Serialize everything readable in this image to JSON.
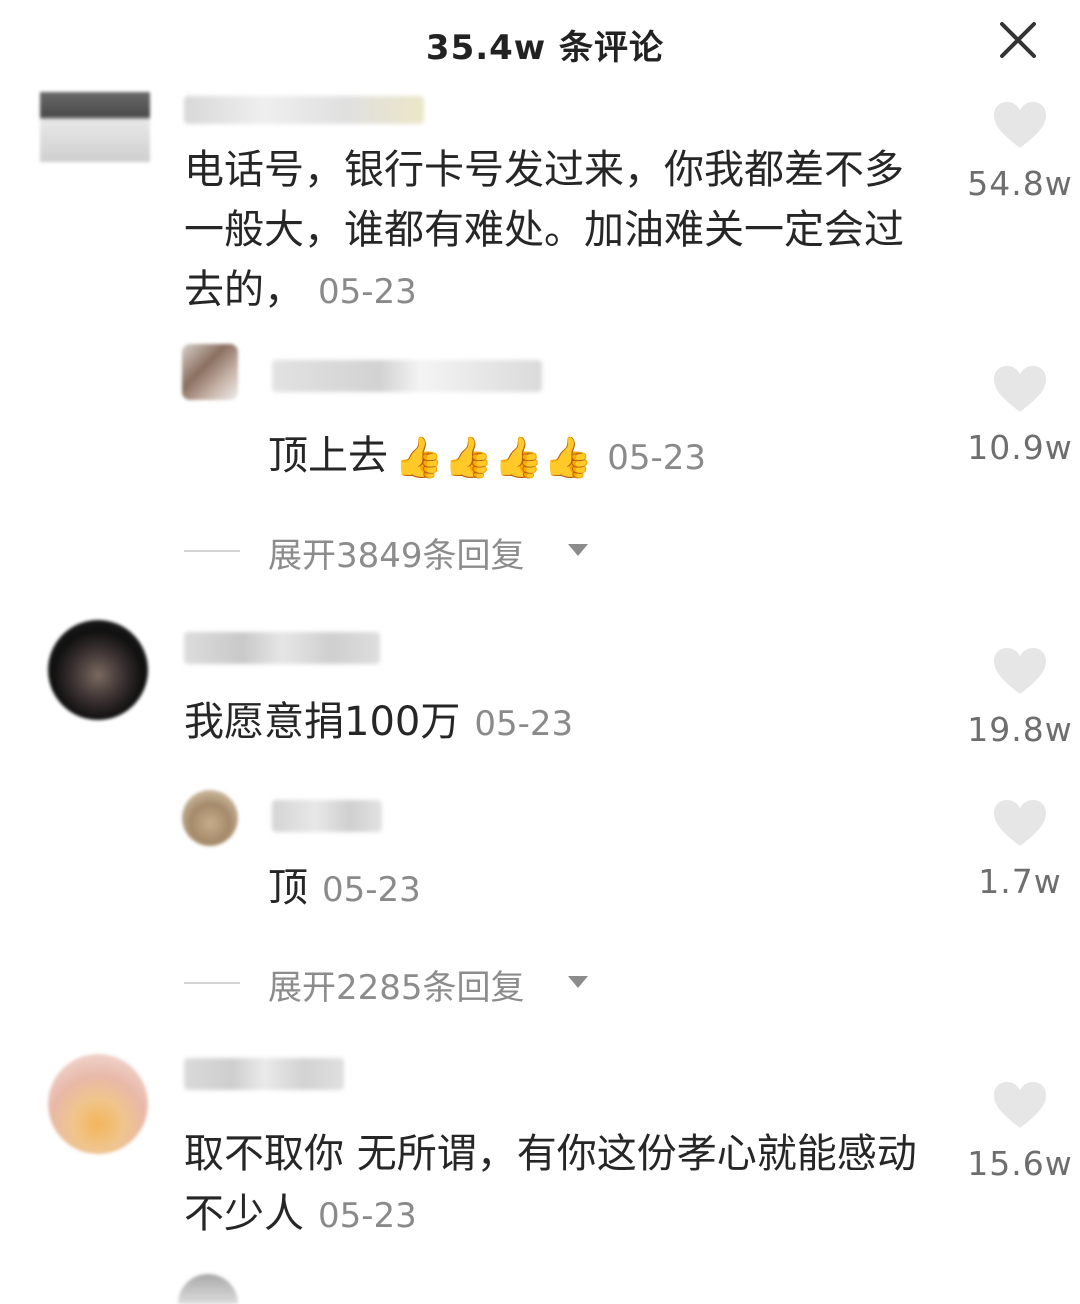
{
  "header": {
    "title": "35.4w 条评论",
    "close_icon": "close-icon"
  },
  "comments": [
    {
      "text": "电话号，银行卡号发过来，你我都差不多一般大，谁都有难处。加油难关一定会过去的，",
      "time": "05-23",
      "likes": "54.8w",
      "reply": {
        "text": "顶上去",
        "emoji": "👍👍👍👍",
        "time": "05-23",
        "likes": "10.9w"
      },
      "expand_label": "展开3849条回复"
    },
    {
      "text": "我愿意捐100万",
      "time": "05-23",
      "likes": "19.8w",
      "reply": {
        "text": "顶",
        "time": "05-23",
        "likes": "1.7w"
      },
      "expand_label": "展开2285条回复"
    },
    {
      "text": "取不取你 无所谓，有你这份孝心就能感动不少人",
      "time": "05-23",
      "likes": "15.6w"
    }
  ],
  "icons": {
    "like": "heart-icon",
    "expand": "caret-down-icon"
  }
}
